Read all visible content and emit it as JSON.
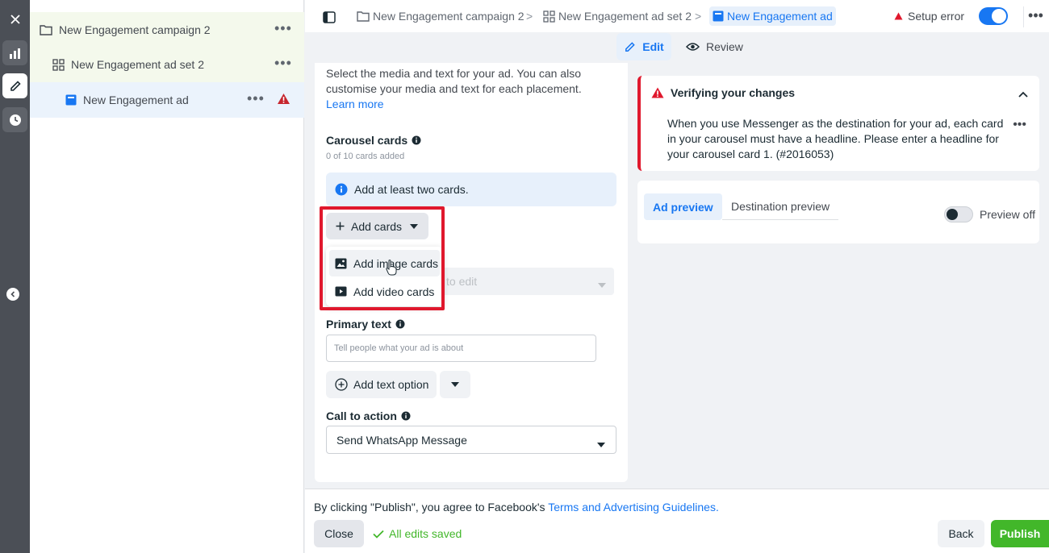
{
  "colors": {
    "accent": "#1877f2",
    "error": "#e0182d",
    "success": "#42b72a"
  },
  "tree": {
    "campaign": "New Engagement campaign 2",
    "adset": "New Engagement ad set 2",
    "ad": "New Engagement ad",
    "more": "•••"
  },
  "breadcrumb": {
    "campaign": "New Engagement campaign 2",
    "adset": "New Engagement ad set 2",
    "ad": "New Engagement ad",
    "separator": ">"
  },
  "status": {
    "setup_error": "Setup error",
    "more": "•••"
  },
  "tabs": {
    "edit": "Edit",
    "review": "Review"
  },
  "editor": {
    "intro": "Select the media and text for your ad. You can also customise your media and text for each placement.",
    "learn_more": "Learn more",
    "carousel_title": "Carousel cards",
    "carousel_count": "0 of 10 cards added",
    "info": "Add at least two cards.",
    "add_cards": "Add cards",
    "menu_image": "Add image cards",
    "menu_video": "Add video cards",
    "ghost_dropdown": "to edit",
    "primary_text_title": "Primary text",
    "primary_text_placeholder": "Tell people what your ad is about",
    "add_text_option": "Add text option",
    "cta_title": "Call to action",
    "cta_value": "Send WhatsApp Message"
  },
  "alert": {
    "title": "Verifying your changes",
    "body": "When you use Messenger as the destination for your ad, each card in your carousel must have a headline. Please enter a headline for your carousel card 1. (#2016053)",
    "more": "•••"
  },
  "preview": {
    "ad_preview": "Ad preview",
    "destination_preview": "Destination preview",
    "toggle_label": "Preview off"
  },
  "footer": {
    "legal_prefix": "By clicking \"Publish\", you agree to Facebook's",
    "legal_link": "Terms and Advertising Guidelines.",
    "close": "Close",
    "saved": "All edits saved",
    "back": "Back",
    "publish": "Publish"
  }
}
